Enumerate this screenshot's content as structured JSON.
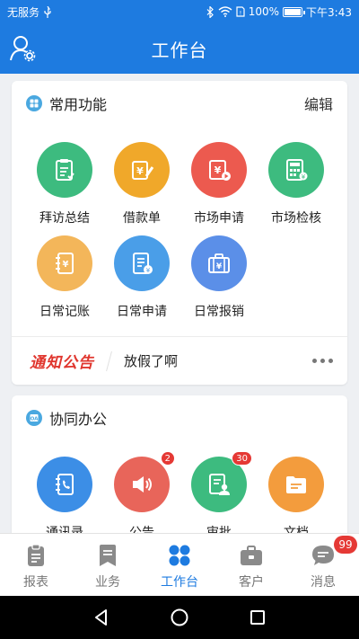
{
  "status_bar": {
    "carrier": "无服务",
    "battery_text": "100%",
    "battery_level": 1.0,
    "time": "下午3:43"
  },
  "header": {
    "title": "工作台"
  },
  "common_functions": {
    "title": "常用功能",
    "edit_label": "编辑",
    "items": [
      {
        "label": "拜访总结",
        "icon": "clipboard-check-icon",
        "color": "#3dbb7f"
      },
      {
        "label": "借款单",
        "icon": "yuan-pen-icon",
        "color": "#f0a82a"
      },
      {
        "label": "市场申请",
        "icon": "yuan-play-icon",
        "color": "#ec5a4f"
      },
      {
        "label": "市场检核",
        "icon": "calculator-icon",
        "color": "#3dbb7f"
      },
      {
        "label": "日常记账",
        "icon": "yuan-notebook-icon",
        "color": "#f3b65a"
      },
      {
        "label": "日常申请",
        "icon": "yuan-document-icon",
        "color": "#4a9ee8"
      },
      {
        "label": "日常报销",
        "icon": "yuan-briefcase-icon",
        "color": "#5b8fe8"
      }
    ]
  },
  "notice": {
    "logo_text": "通知公告",
    "message": "放假了啊"
  },
  "collaboration": {
    "title": "协同办公",
    "items": [
      {
        "label": "通讯录",
        "icon": "phonebook-icon",
        "color": "#3c8ee6",
        "badge": ""
      },
      {
        "label": "公告",
        "icon": "speaker-icon",
        "color": "#e8655a",
        "badge": "2"
      },
      {
        "label": "审批",
        "icon": "approval-icon",
        "color": "#3dbb7f",
        "badge": "30"
      },
      {
        "label": "文档",
        "icon": "folder-icon",
        "color": "#f39c3d",
        "badge": ""
      }
    ]
  },
  "tabbar": {
    "items": [
      {
        "label": "报表",
        "icon": "report-icon",
        "active": false,
        "badge": ""
      },
      {
        "label": "业务",
        "icon": "business-icon",
        "active": false,
        "badge": ""
      },
      {
        "label": "工作台",
        "icon": "workbench-icon",
        "active": true,
        "badge": ""
      },
      {
        "label": "客户",
        "icon": "customer-icon",
        "active": false,
        "badge": ""
      },
      {
        "label": "消息",
        "icon": "message-icon",
        "active": false,
        "badge": "99"
      }
    ]
  },
  "colors": {
    "primary": "#1e7be0",
    "badge": "#e53935",
    "notice_red": "#e0362e"
  }
}
